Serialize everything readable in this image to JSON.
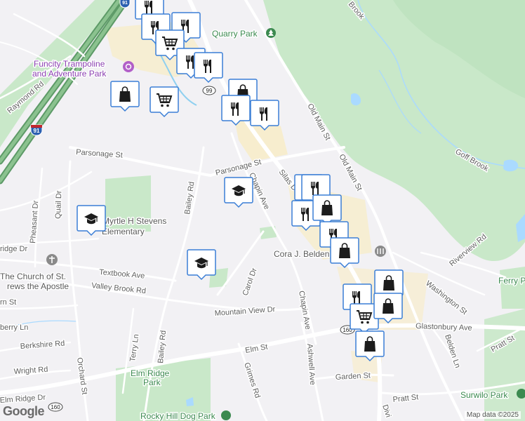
{
  "map": {
    "attribution": "Map data ©2025",
    "logo": "Google"
  },
  "roads": {
    "old_main_st_a": "Old Main St",
    "old_main_st_b": "Old Main St",
    "parsonage_st_a": "Parsonage St",
    "parsonage_st_b": "Parsonage St",
    "silas_deane": "Silas D",
    "chapin_ave_a": "Chapin Ave",
    "chapin_ave_b": "Chapin Ave",
    "bailey_rd_a": "Bailey Rd",
    "bailey_rd_b": "Bailey Rd",
    "textbook_ave": "Textbook Ave",
    "valley_brook_rd": "Valley Brook Rd",
    "carol_dr": "Carol Dr",
    "mountain_view_dr": "Mountain View Dr",
    "elm_st": "Elm St",
    "grimes_rd": "Grimes Rd",
    "ashwell_ave": "Ashwell Ave",
    "garden_st": "Garden St",
    "pratt_st_a": "Pratt St",
    "pratt_st_b": "Pratt St",
    "riverview_rd": "Riverview Rd",
    "washington_st": "Washington St",
    "glastonbury_ave": "Glastonbury Ave",
    "belden_ln": "Belden Ln",
    "raymond_rd": "Raymond Rd",
    "quail_dr": "Quail Dr",
    "pheasant_dr": "Pheasant Dr",
    "ridge_dr": "ridge Dr",
    "rn_st": "rn St",
    "berry_ln": "berry Ln",
    "berkshire_rd": "Berkshire Rd",
    "wright_rd": "Wright Rd",
    "orchard_st": "Orchard St",
    "terry_ln": "Terry Ln",
    "elm_ridge_dr": "Elm Ridge Dr",
    "div": "Divi",
    "goff_brook": "Goff Brook",
    "brook_top": "Brook",
    "i91": "91",
    "i91_top": "91",
    "route_99": "99",
    "route_160_a": "160",
    "route_160_b": "160"
  },
  "places": {
    "quarry_park": "Quarry Park",
    "funcity_line1": "Funcity Trampoline",
    "funcity_line2": "and Adventure Park",
    "myrtle_line1": "Myrtle H Stevens",
    "myrtle_line2": "Elementary",
    "church_line1": "The Church of St.",
    "church_line2": "rews the Apostle",
    "cora_belden": "Cora J. Belden Library",
    "elm_ridge_park_line1": "Elm Ridge",
    "elm_ridge_park_line2": "Park",
    "rocky_hill_dog_park": "Rocky Hill Dog Park",
    "surwilo_park": "Surwilo Park",
    "ferry_park": "Ferry P"
  },
  "markers": [
    {
      "type": "restaurant",
      "label": "Restaurant"
    },
    {
      "type": "restaurant",
      "label": "Restaurant"
    },
    {
      "type": "restaurant",
      "label": "Restaurant"
    },
    {
      "type": "grocery",
      "label": "Grocery store"
    },
    {
      "type": "restaurant",
      "label": "Restaurant"
    },
    {
      "type": "restaurant",
      "label": "Restaurant"
    },
    {
      "type": "shopping",
      "label": "Shopping"
    },
    {
      "type": "grocery",
      "label": "Grocery store"
    },
    {
      "type": "shopping",
      "label": "Shopping"
    },
    {
      "type": "restaurant",
      "label": "Restaurant"
    },
    {
      "type": "restaurant",
      "label": "Restaurant"
    },
    {
      "type": "school",
      "label": "School"
    },
    {
      "type": "school",
      "label": "School"
    },
    {
      "type": "school",
      "label": "School"
    },
    {
      "type": "restaurant",
      "label": "Restaurant"
    },
    {
      "type": "restaurant",
      "label": "Restaurant"
    },
    {
      "type": "restaurant",
      "label": "Restaurant"
    },
    {
      "type": "shopping",
      "label": "Shopping"
    },
    {
      "type": "restaurant",
      "label": "Restaurant"
    },
    {
      "type": "shopping",
      "label": "Shopping"
    },
    {
      "type": "shopping",
      "label": "Shopping"
    },
    {
      "type": "restaurant",
      "label": "Restaurant"
    },
    {
      "type": "grocery",
      "label": "Grocery store"
    },
    {
      "type": "shopping",
      "label": "Shopping"
    },
    {
      "type": "shopping",
      "label": "Shopping"
    }
  ],
  "colors": {
    "park": "#c9e8c9",
    "water": "#aadaff",
    "highway": "#5d9a67",
    "road": "#ffffff",
    "marker_fill": "#ffffff",
    "marker_stroke": "#3a7ed6",
    "icon": "#1c1c1c"
  }
}
